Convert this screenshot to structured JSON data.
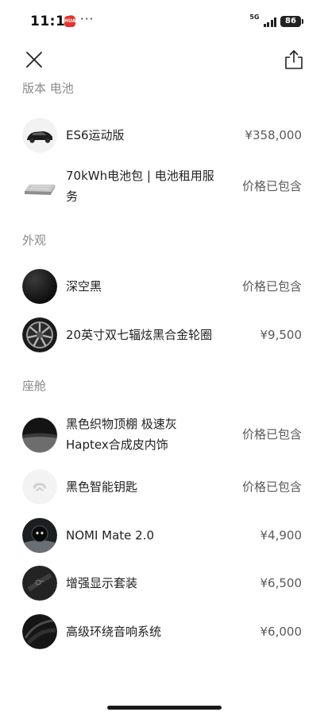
{
  "status_bar": {
    "time": "11:16",
    "app_badge": "HUAWEI",
    "more": "···",
    "network": "5G",
    "battery": "86"
  },
  "header": {
    "close_icon": "close-icon",
    "share_icon": "share-icon"
  },
  "sections": {
    "version_battery": {
      "title": "版本 电池",
      "items": [
        {
          "name": "ES6运动版",
          "price": "¥358,000"
        },
        {
          "name_line1": "70kWh电池包 | 电池租用服",
          "name_line2": "务",
          "price": "价格已包含"
        }
      ]
    },
    "exterior": {
      "title": "外观",
      "items": [
        {
          "name": "深空黑",
          "price": "价格已包含"
        },
        {
          "name": "20英寸双七辐炫黑合金轮圈",
          "price": "¥9,500"
        }
      ]
    },
    "cabin": {
      "title": "座舱",
      "items": [
        {
          "name_line1": "黑色织物顶棚 极速灰",
          "name_line2": "Haptex合成皮内饰",
          "price": "价格已包含"
        },
        {
          "name": "黑色智能钥匙",
          "price": "价格已包含"
        },
        {
          "name": "NOMI Mate 2.0",
          "price": "¥4,900"
        },
        {
          "name": "增强显示套装",
          "price": "¥6,500"
        },
        {
          "name": "高级环绕音响系统",
          "price": "¥6,000"
        }
      ]
    }
  },
  "colors": {
    "section_title": "#8a8a8a",
    "text": "#1f1f1f",
    "price": "#5a5a5a"
  }
}
